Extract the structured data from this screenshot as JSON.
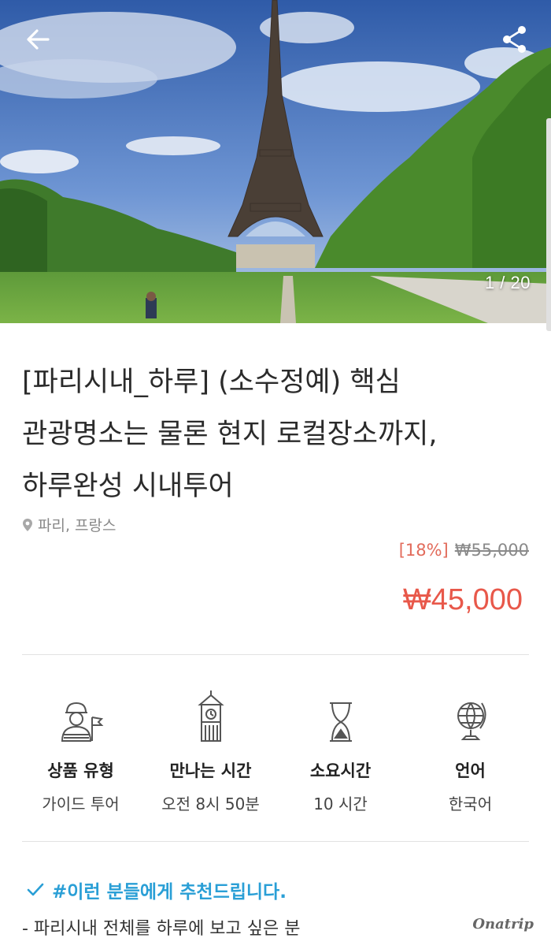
{
  "hero": {
    "counter": "1 / 20",
    "back_icon": "arrow-left-icon",
    "share_icon": "share-icon"
  },
  "product": {
    "title_lines": [
      "[파리시내_하루] (소수정예) 핵심",
      "관광명소는 물론 현지 로컬장소까지,",
      "하루완성 시내투어"
    ],
    "location": "파리, 프랑스",
    "discount": "[18%]",
    "original_price": "₩55,000",
    "final_price": "₩45,000"
  },
  "info": [
    {
      "icon": "guide-icon",
      "label": "상품 유형",
      "value": "가이드 투어"
    },
    {
      "icon": "clock-tower-icon",
      "label": "만나는 시간",
      "value": "오전 8시 50분"
    },
    {
      "icon": "hourglass-icon",
      "label": "소요시간",
      "value": "10 시간"
    },
    {
      "icon": "globe-icon",
      "label": "언어",
      "value": "한국어"
    }
  ],
  "recommend": {
    "heading": "#이런 분들에게 추천드립니다.",
    "first_item": "- 파리시내 전체를 하루에 보고 싶은 분"
  },
  "watermark": "Onatrip",
  "colors": {
    "accent_blue": "#2a9fd6",
    "price_red": "#e8584a",
    "discount_red": "#e26b5b"
  }
}
